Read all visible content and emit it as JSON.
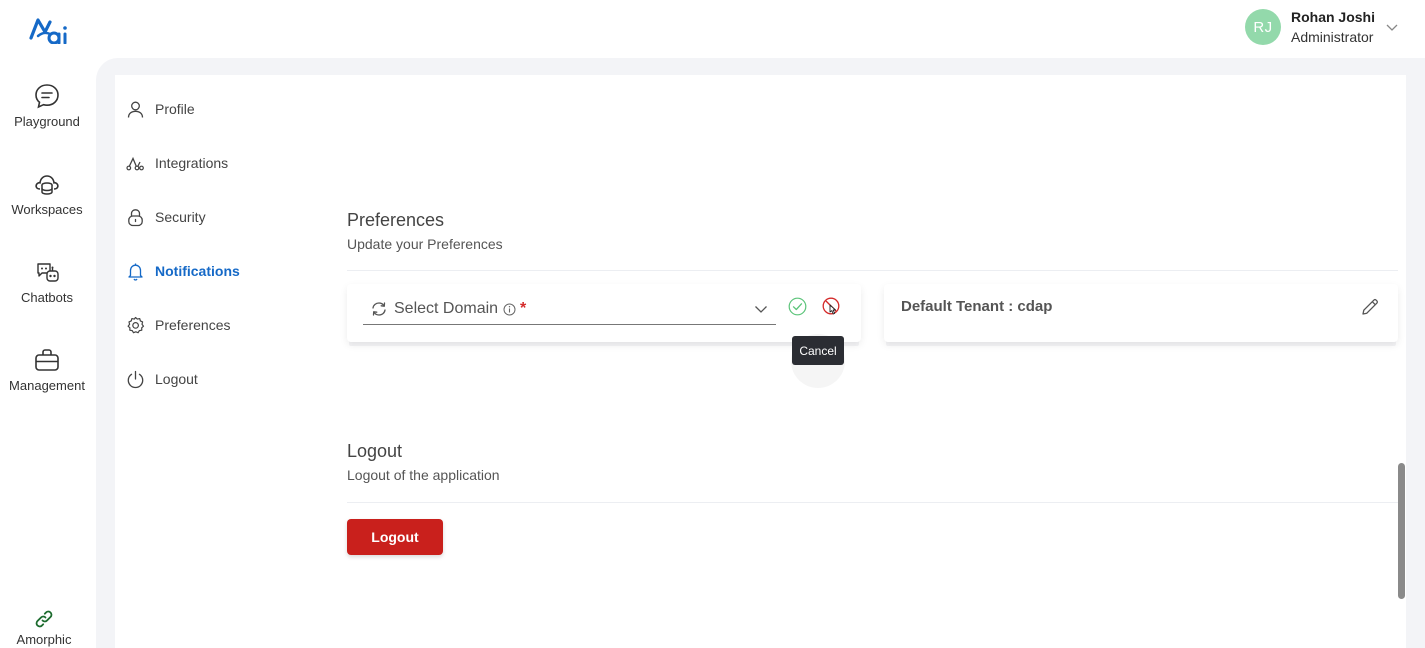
{
  "header": {
    "user": {
      "initials": "RJ",
      "name": "Rohan Joshi",
      "role": "Administrator"
    }
  },
  "rail": {
    "items": [
      {
        "label": "Playground",
        "icon": "chat-bubble-icon"
      },
      {
        "label": "Workspaces",
        "icon": "database-cloud-icon"
      },
      {
        "label": "Chatbots",
        "icon": "chatbot-icon"
      },
      {
        "label": "Management",
        "icon": "briefcase-icon"
      }
    ],
    "footer": {
      "label": "Amorphic",
      "icon": "link-icon"
    }
  },
  "menu": {
    "items": [
      {
        "label": "Profile",
        "icon": "user-icon"
      },
      {
        "label": "Integrations",
        "icon": "integrations-icon"
      },
      {
        "label": "Security",
        "icon": "lock-icon"
      },
      {
        "label": "Notifications",
        "icon": "bell-icon",
        "active": true
      },
      {
        "label": "Preferences",
        "icon": "gear-icon"
      },
      {
        "label": "Logout",
        "icon": "power-icon"
      }
    ]
  },
  "preferences": {
    "title": "Preferences",
    "subtitle": "Update your Preferences",
    "select_placeholder": "Select Domain",
    "required_mark": "*",
    "tooltip": "Cancel",
    "tenant_label": "Default Tenant : cdap"
  },
  "logout": {
    "title": "Logout",
    "subtitle": "Logout of the application",
    "button_label": "Logout"
  },
  "colors": {
    "accent": "#1569c7",
    "danger": "#c9201c",
    "success": "#5cc47a",
    "avatar": "#93d9ab"
  }
}
